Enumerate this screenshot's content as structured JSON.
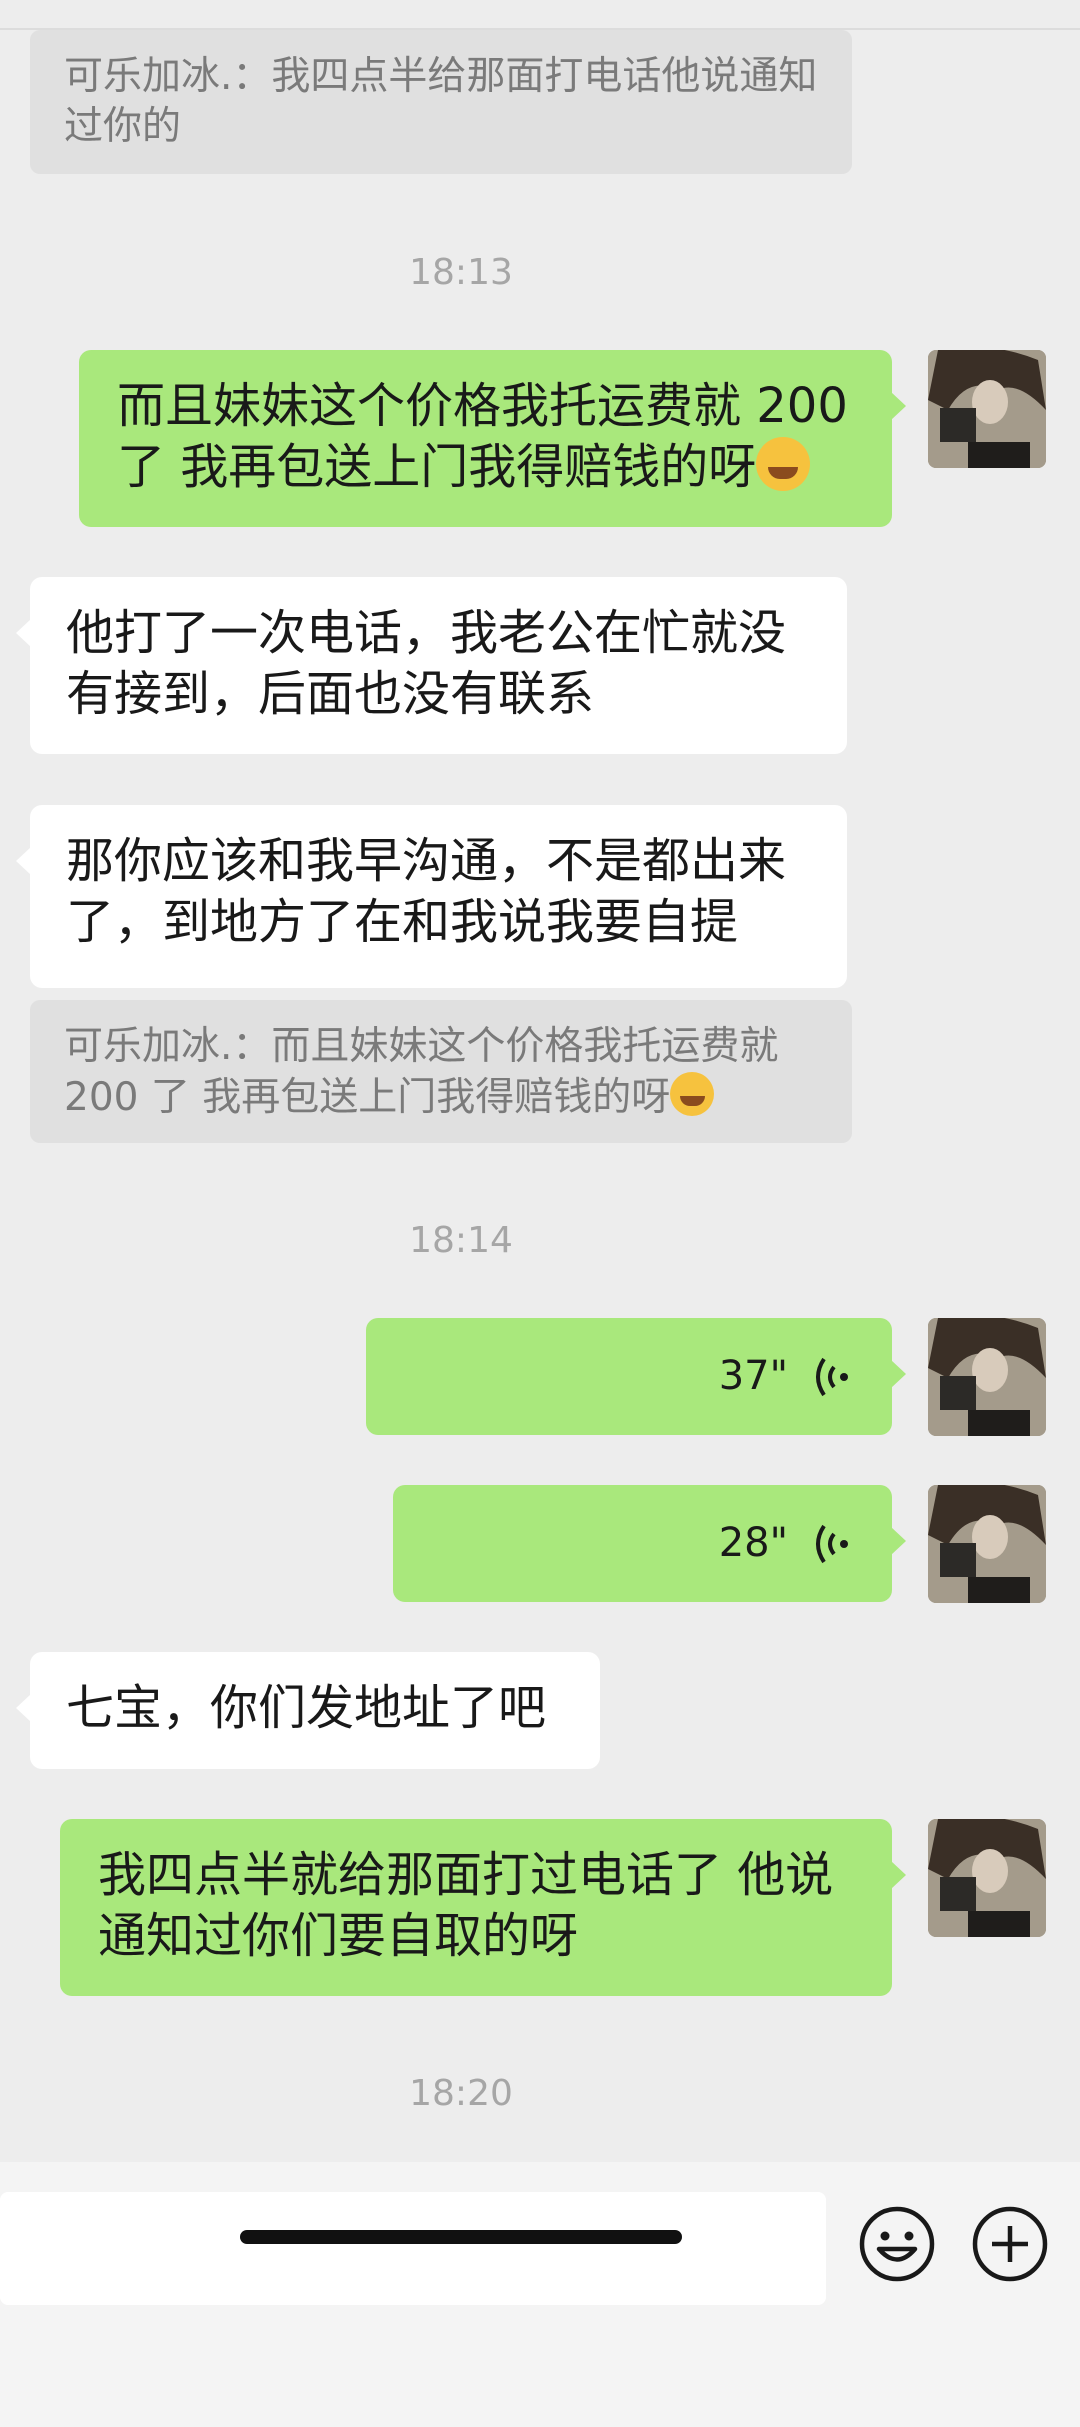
{
  "chat": {
    "quote_1": "可乐加冰.：我四点半给那面打电话他说通知过你的",
    "time_1": "18:13",
    "msg_1": "而且妹妹这个价格我托运费就 200 了 我再包送上门我得赔钱的呀",
    "msg_2": "他打了一次电话，我老公在忙就没有接到，后面也没有联系",
    "msg_3": "那你应该和我早沟通，不是都出来了，到地方了在和我说我要自提",
    "quote_2": "可乐加冰.：而且妹妹这个价格我托运费就 200 了 我再包送上门我得赔钱的呀",
    "time_2": "18:14",
    "voice_1_duration": "37\"",
    "voice_2_duration": "28\"",
    "msg_4": "七宝，你们发地址了吧",
    "msg_5": "我四点半就给那面打过电话了 他说通知过你们要自取的呀",
    "time_3": "18:20"
  },
  "icons": {
    "emoji": "laughing-crying-emoji",
    "voice": "voice-wave-icon",
    "emoji_button": "smiley-face-icon",
    "plus_button": "plus-circle-icon"
  },
  "colors": {
    "background": "#ededed",
    "outgoing_bubble": "#a9e87c",
    "incoming_bubble": "#ffffff",
    "quote": "#e0e0e0"
  }
}
